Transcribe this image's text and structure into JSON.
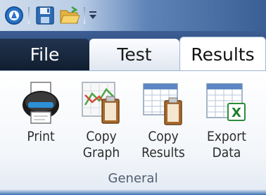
{
  "quick_access": {
    "items": [
      {
        "icon": "app-logo-icon"
      },
      {
        "icon": "save-icon"
      },
      {
        "icon": "open-folder-icon"
      },
      {
        "icon": "customize-dropdown-icon"
      }
    ]
  },
  "tabs": [
    {
      "label": "File"
    },
    {
      "label": "Test"
    },
    {
      "label": "Results",
      "selected": true
    }
  ],
  "ribbon": {
    "group_label": "General",
    "commands": [
      {
        "label": "Print",
        "icon": "printer-icon"
      },
      {
        "label": "Copy\nGraph",
        "icon": "copy-graph-icon"
      },
      {
        "label": "Copy\nResults",
        "icon": "copy-results-icon"
      },
      {
        "label": "Export\nData",
        "icon": "excel-export-icon"
      }
    ]
  },
  "colors": {
    "file_tab": "#1a2a42",
    "ribbon_accent": "#2b4a78"
  }
}
